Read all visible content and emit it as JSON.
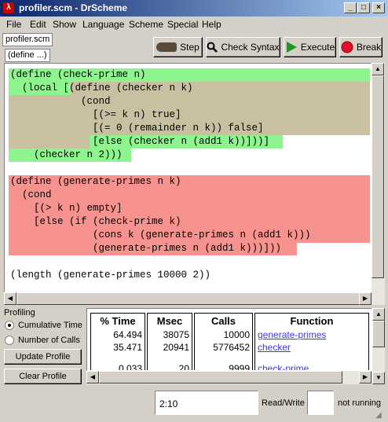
{
  "window": {
    "title": "profiler.scm - DrScheme",
    "app_icon": "lambda-icon",
    "controls": [
      "_",
      "□",
      "×"
    ]
  },
  "menu": [
    "File",
    "Edit",
    "Show",
    "Language",
    "Scheme",
    "Special",
    "Help"
  ],
  "toolbar": {
    "file_tab": "profiler.scm",
    "define_popup": "(define ...)",
    "step_label": "Step",
    "check_syntax_label": "Check Syntax",
    "execute_label": "Execute",
    "break_label": "Break",
    "icons": [
      "footprint-icon",
      "magnifier-icon",
      "play-arrow-icon",
      "stop-icon"
    ],
    "execute_color": "#1a9a1a",
    "break_color": "#e0102a"
  },
  "editor": {
    "lines": [
      "(define (check-prime n)",
      "  (local [(define (checker n k)",
      "            (cond",
      "              [(>= k n) true]",
      "              [(= 0 (remainder n k)) false]",
      "              [else (checker n (add1 k))]))]",
      "    (checker n 2)))",
      "",
      "(define (generate-primes n k)",
      "  (cond",
      "    [(> k n) empty]",
      "    [else (if (check-prime k)",
      "              (cons k (generate-primes n (add1 k)))",
      "              (generate-primes n (add1 k)))]))",
      "",
      "(length (generate-primes 10000 2))"
    ],
    "highlight_colors": {
      "hot": "#8ef58e",
      "warm": "#c8c0a0",
      "cold": "#f6938f"
    }
  },
  "profiling": {
    "label": "Profiling",
    "options": [
      {
        "label": "Cumulative Time",
        "selected": true
      },
      {
        "label": "Number of Calls",
        "selected": false
      }
    ],
    "update_button": "Update Profile",
    "clear_button": "Clear Profile",
    "columns": [
      "% Time",
      "Msec",
      "Calls",
      "Function"
    ],
    "rows": [
      {
        "time": "64.494",
        "msec": "38075",
        "calls": "10000",
        "function": "generate-primes"
      },
      {
        "time": "35.471",
        "msec": "20941",
        "calls": "5776452",
        "function": "checker"
      },
      {
        "time": "0.033",
        "msec": "20",
        "calls": "9999",
        "function": "check-prime"
      }
    ]
  },
  "status": {
    "position": "2:10",
    "mode": "Read/Write",
    "state": "not running"
  }
}
